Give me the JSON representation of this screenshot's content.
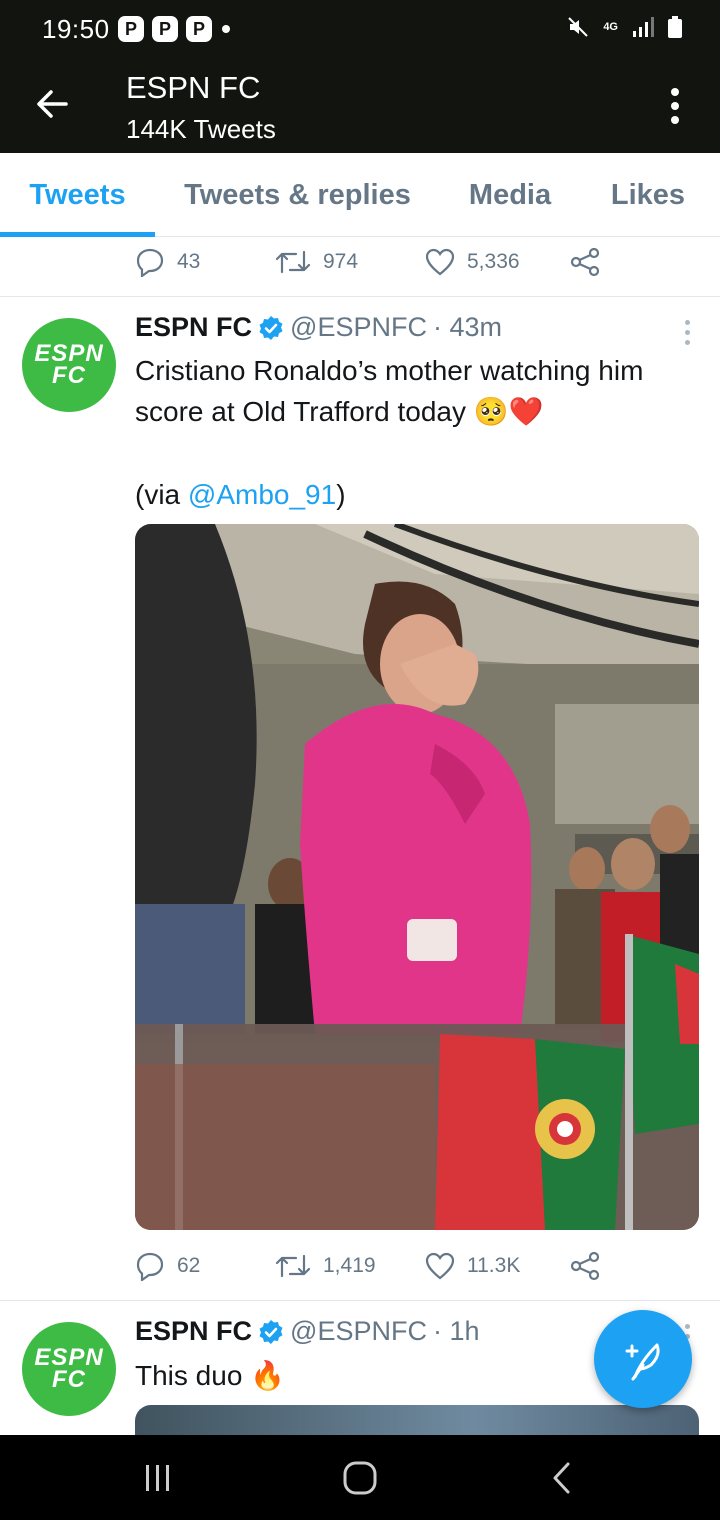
{
  "status_bar": {
    "time": "19:50",
    "notification_icons": [
      "P",
      "P",
      "P"
    ],
    "network": "4G"
  },
  "app_bar": {
    "title": "ESPN FC",
    "subtitle": "144K Tweets"
  },
  "tabs": [
    {
      "label": "Tweets",
      "active": true
    },
    {
      "label": "Tweets & replies",
      "active": false
    },
    {
      "label": "Media",
      "active": false
    },
    {
      "label": "Likes",
      "active": false
    }
  ],
  "prev_tweet_actions": {
    "replies": "43",
    "retweets": "974",
    "likes": "5,336"
  },
  "tweets": [
    {
      "name": "ESPN FC",
      "avatar_text": [
        "ESPN",
        "FC"
      ],
      "handle": "@ESPNFC",
      "time": "· 43m",
      "text_line1": "Cristiano Ronaldo’s mother watching him score at Old Trafford today 🥺❤️",
      "via_prefix": "(via ",
      "via_mention": "@Ambo_91",
      "via_suffix": ")",
      "actions": {
        "replies": "62",
        "retweets": "1,419",
        "likes": "11.3K"
      }
    },
    {
      "name": "ESPN FC",
      "avatar_text": [
        "ESPN",
        "FC"
      ],
      "handle": "@ESPNFC",
      "time": "· 1h",
      "text_line1": "This duo 🔥"
    }
  ],
  "colors": {
    "accent": "#1da1f2",
    "status_bg": "#12140f",
    "avatar_green": "#3dbb45",
    "muted": "#657786"
  }
}
